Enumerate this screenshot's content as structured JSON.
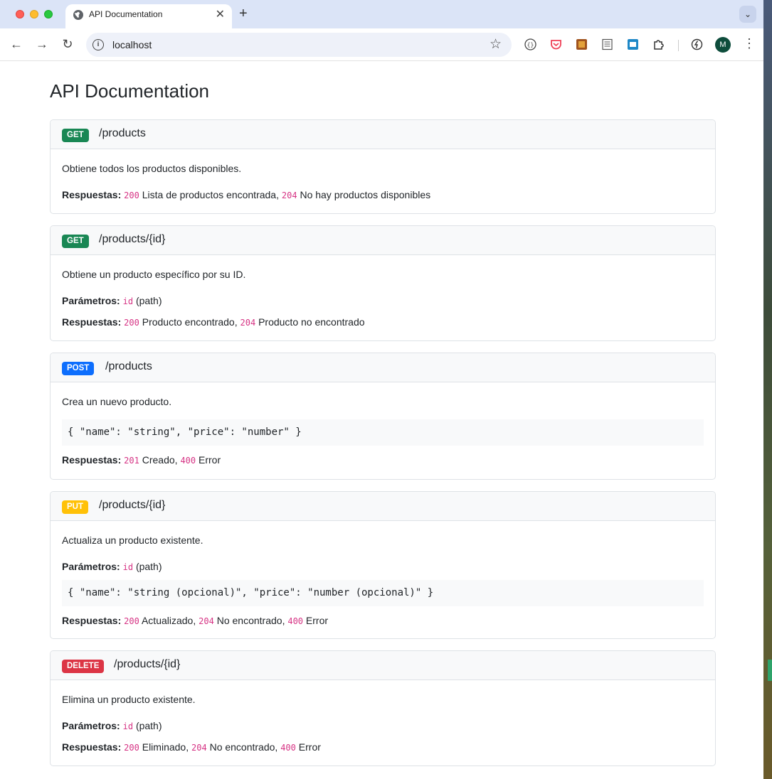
{
  "browser": {
    "tab_title": "API Documentation",
    "tab_close": "✕",
    "new_tab": "+",
    "tab_menu": "⌄",
    "url": "localhost",
    "avatar_letter": "M"
  },
  "page": {
    "title": "API Documentation"
  },
  "labels": {
    "responses": "Respuestas:",
    "params": "Parámetros:"
  },
  "endpoints": [
    {
      "method": "GET",
      "path": "/products",
      "description": "Obtiene todos los productos disponibles.",
      "responses": [
        {
          "code": "200",
          "text": "Lista de productos encontrada"
        },
        {
          "code": "204",
          "text": "No hay productos disponibles"
        }
      ]
    },
    {
      "method": "GET",
      "path": "/products/{id}",
      "description": "Obtiene un producto específico por su ID.",
      "param": {
        "name": "id",
        "kind": "(path)"
      },
      "responses": [
        {
          "code": "200",
          "text": "Producto encontrado"
        },
        {
          "code": "204",
          "text": "Producto no encontrado"
        }
      ]
    },
    {
      "method": "POST",
      "path": "/products",
      "description": "Crea un nuevo producto.",
      "body": "{ \"name\": \"string\", \"price\": \"number\" }",
      "responses": [
        {
          "code": "201",
          "text": "Creado"
        },
        {
          "code": "400",
          "text": "Error"
        }
      ]
    },
    {
      "method": "PUT",
      "path": "/products/{id}",
      "description": "Actualiza un producto existente.",
      "param": {
        "name": "id",
        "kind": "(path)"
      },
      "body": "{ \"name\": \"string (opcional)\", \"price\": \"number (opcional)\" }",
      "responses": [
        {
          "code": "200",
          "text": "Actualizado"
        },
        {
          "code": "204",
          "text": "No encontrado"
        },
        {
          "code": "400",
          "text": "Error"
        }
      ]
    },
    {
      "method": "DELETE",
      "path": "/products/{id}",
      "description": "Elimina un producto existente.",
      "param": {
        "name": "id",
        "kind": "(path)"
      },
      "responses": [
        {
          "code": "200",
          "text": "Eliminado"
        },
        {
          "code": "204",
          "text": "No encontrado"
        },
        {
          "code": "400",
          "text": "Error"
        }
      ]
    }
  ],
  "colors": {
    "get": "#198754",
    "post": "#0d6efd",
    "put": "#ffc107",
    "delete": "#dc3545",
    "code": "#d63384"
  }
}
